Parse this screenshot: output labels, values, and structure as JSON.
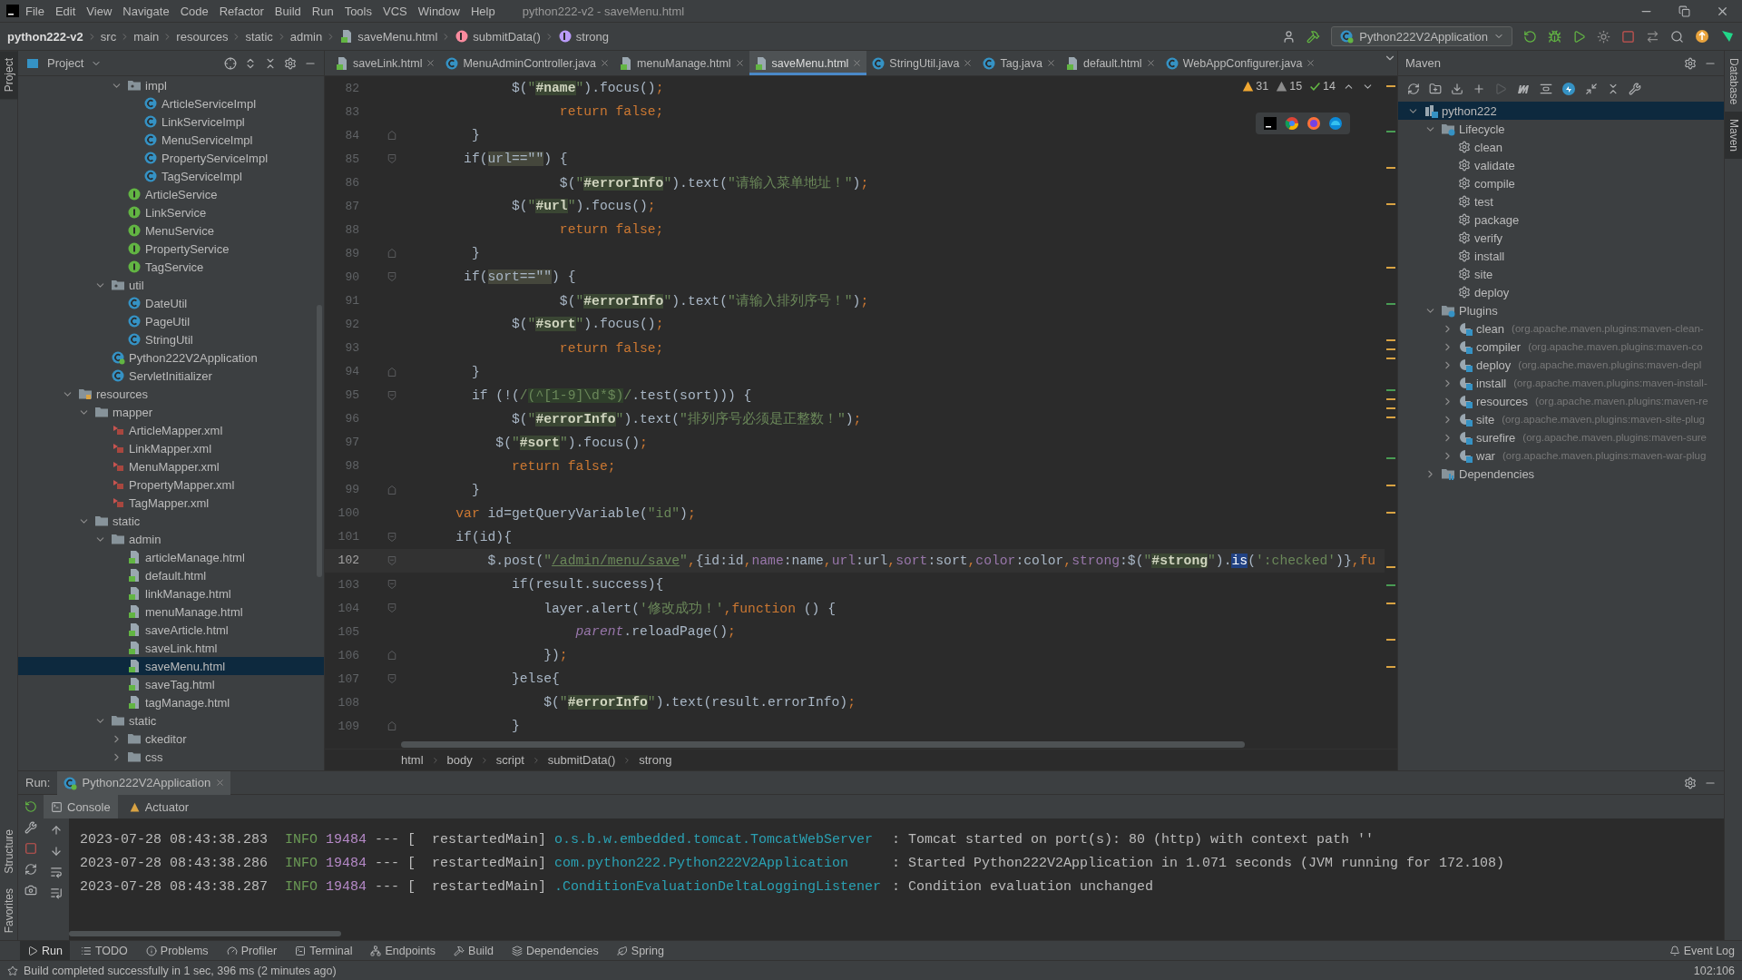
{
  "title_bar": {
    "menu": [
      "File",
      "Edit",
      "View",
      "Navigate",
      "Code",
      "Refactor",
      "Build",
      "Run",
      "Tools",
      "VCS",
      "Window",
      "Help"
    ],
    "title": "python222-v2 - saveMenu.html"
  },
  "nav_bar": {
    "crumbs": [
      {
        "label": "python222-v2",
        "kind": "project"
      },
      {
        "label": "src",
        "kind": "folder"
      },
      {
        "label": "main",
        "kind": "folder"
      },
      {
        "label": "resources",
        "kind": "folder"
      },
      {
        "label": "static",
        "kind": "folder"
      },
      {
        "label": "admin",
        "kind": "folder"
      },
      {
        "label": "saveMenu.html",
        "kind": "html"
      },
      {
        "label": "submitData()",
        "kind": "function"
      },
      {
        "label": "strong",
        "kind": "field"
      }
    ],
    "run_config": "Python222V2Application"
  },
  "left_stripe": [
    {
      "label": "Project",
      "selected": true
    }
  ],
  "left_stripe_bottom": [
    {
      "label": "Structure",
      "selected": false
    },
    {
      "label": "Favorites",
      "selected": false
    }
  ],
  "right_stripe": [
    {
      "label": "Database",
      "selected": false
    },
    {
      "label": "Maven",
      "selected": true
    }
  ],
  "project_panel": {
    "title": "Project",
    "tree": [
      {
        "children": [
          {
            "children": [
              {
                "children": [
                  {
                    "label": "impl",
                    "kind": "package",
                    "expanded": true,
                    "selected": false,
                    "children": [
                      {
                        "label": "ArticleServiceImpl",
                        "kind": "class",
                        "selected": false
                      },
                      {
                        "label": "LinkServiceImpl",
                        "kind": "class",
                        "selected": false
                      },
                      {
                        "label": "MenuServiceImpl",
                        "kind": "class",
                        "selected": false
                      },
                      {
                        "label": "PropertyServiceImpl",
                        "kind": "class",
                        "selected": false
                      },
                      {
                        "label": "TagServiceImpl",
                        "kind": "class",
                        "selected": false
                      }
                    ]
                  },
                  {
                    "label": "ArticleService",
                    "kind": "interface",
                    "selected": false
                  },
                  {
                    "label": "LinkService",
                    "kind": "interface",
                    "selected": false
                  },
                  {
                    "label": "MenuService",
                    "kind": "interface",
                    "selected": false
                  },
                  {
                    "label": "PropertyService",
                    "kind": "interface",
                    "selected": false
                  },
                  {
                    "label": "TagService",
                    "kind": "interface",
                    "selected": false
                  }
                ]
              },
              {
                "label": "util",
                "kind": "package",
                "expanded": true,
                "selected": false,
                "children": [
                  {
                    "label": "DateUtil",
                    "kind": "class",
                    "selected": false
                  },
                  {
                    "label": "PageUtil",
                    "kind": "class",
                    "selected": false
                  },
                  {
                    "label": "StringUtil",
                    "kind": "class",
                    "selected": false
                  }
                ]
              },
              {
                "label": "Python222V2Application",
                "kind": "app",
                "selected": false
              },
              {
                "label": "ServletInitializer",
                "kind": "class",
                "selected": false
              }
            ]
          }
        ]
      },
      {
        "label": "resources",
        "kind": "resources",
        "expanded": true,
        "selected": false,
        "children": [
          {
            "label": "mapper",
            "kind": "folder",
            "expanded": true,
            "selected": false,
            "children": [
              {
                "label": "ArticleMapper.xml",
                "kind": "xml",
                "selected": false
              },
              {
                "label": "LinkMapper.xml",
                "kind": "xml",
                "selected": false
              },
              {
                "label": "MenuMapper.xml",
                "kind": "xml",
                "selected": false
              },
              {
                "label": "PropertyMapper.xml",
                "kind": "xml",
                "selected": false
              },
              {
                "label": "TagMapper.xml",
                "kind": "xml",
                "selected": false
              }
            ]
          },
          {
            "label": "static",
            "kind": "folder",
            "expanded": true,
            "selected": false,
            "children": [
              {
                "label": "admin",
                "kind": "folder",
                "expanded": true,
                "selected": false,
                "children": [
                  {
                    "label": "articleManage.html",
                    "kind": "html",
                    "selected": false
                  },
                  {
                    "label": "default.html",
                    "kind": "html",
                    "selected": false
                  },
                  {
                    "label": "linkManage.html",
                    "kind": "html",
                    "selected": false
                  },
                  {
                    "label": "menuManage.html",
                    "kind": "html",
                    "selected": false
                  },
                  {
                    "label": "saveArticle.html",
                    "kind": "html",
                    "selected": false
                  },
                  {
                    "label": "saveLink.html",
                    "kind": "html",
                    "selected": false
                  },
                  {
                    "label": "saveMenu.html",
                    "kind": "html",
                    "selected": true
                  },
                  {
                    "label": "saveTag.html",
                    "kind": "html",
                    "selected": false
                  },
                  {
                    "label": "tagManage.html",
                    "kind": "html",
                    "selected": false
                  }
                ]
              },
              {
                "label": "static",
                "kind": "folder",
                "expanded": true,
                "selected": false,
                "children": [
                  {
                    "label": "ckeditor",
                    "kind": "folder",
                    "expanded": false,
                    "selected": false
                  },
                  {
                    "label": "css",
                    "kind": "folder",
                    "expanded": false,
                    "selected": false
                  }
                ]
              }
            ]
          }
        ]
      }
    ]
  },
  "editor": {
    "tabs": [
      {
        "label": "saveLink.html",
        "kind": "html",
        "selected": false
      },
      {
        "label": "MenuAdminController.java",
        "kind": "class",
        "selected": false
      },
      {
        "label": "menuManage.html",
        "kind": "html",
        "selected": false
      },
      {
        "label": "saveMenu.html",
        "kind": "html",
        "selected": true
      },
      {
        "label": "StringUtil.java",
        "kind": "class",
        "selected": false
      },
      {
        "label": "Tag.java",
        "kind": "class",
        "selected": false
      },
      {
        "label": "default.html",
        "kind": "html",
        "selected": false
      },
      {
        "label": "WebAppConfigurer.java",
        "kind": "class",
        "selected": false
      }
    ],
    "inspections": [
      {
        "count": "31",
        "kind": "warning"
      },
      {
        "count": "15",
        "kind": "weak"
      },
      {
        "count": "14",
        "kind": "ok"
      }
    ],
    "lines": [
      {
        "number": "82",
        "current": false,
        "tokens": [
          {
            "kind": "p",
            "text": "           $("
          },
          {
            "kind": "s",
            "text": "\""
          },
          {
            "kind": "id",
            "text": "#name"
          },
          {
            "kind": "s",
            "text": "\""
          },
          {
            "kind": "p",
            "text": ").focus()"
          },
          {
            "kind": "k",
            "text": ";"
          }
        ]
      },
      {
        "number": "83",
        "current": false,
        "tokens": [
          {
            "kind": "k",
            "text": "                 return false;"
          }
        ]
      },
      {
        "number": "84",
        "current": false,
        "fold": {
          "kind": "end"
        },
        "tokens": [
          {
            "kind": "p",
            "text": "      }"
          }
        ]
      },
      {
        "number": "85",
        "current": false,
        "fold": {
          "kind": "start"
        },
        "tokens": [
          {
            "kind": "p",
            "text": "     if("
          },
          {
            "kind": "h",
            "text": "url==\"\""
          },
          {
            "kind": "p",
            "text": ") {"
          }
        ]
      },
      {
        "number": "86",
        "current": false,
        "tokens": [
          {
            "kind": "p",
            "text": "                 $("
          },
          {
            "kind": "s",
            "text": "\""
          },
          {
            "kind": "id",
            "text": "#errorInfo"
          },
          {
            "kind": "s",
            "text": "\""
          },
          {
            "kind": "p",
            "text": ").text("
          },
          {
            "kind": "s",
            "text": "\"请输入菜单地址！\""
          },
          {
            "kind": "p",
            "text": ")"
          },
          {
            "kind": "k",
            "text": ";"
          }
        ]
      },
      {
        "number": "87",
        "current": false,
        "tokens": [
          {
            "kind": "p",
            "text": "           $("
          },
          {
            "kind": "s",
            "text": "\""
          },
          {
            "kind": "id",
            "text": "#url"
          },
          {
            "kind": "s",
            "text": "\""
          },
          {
            "kind": "p",
            "text": ").focus()"
          },
          {
            "kind": "k",
            "text": ";"
          }
        ]
      },
      {
        "number": "88",
        "current": false,
        "tokens": [
          {
            "kind": "k",
            "text": "                 return false;"
          }
        ]
      },
      {
        "number": "89",
        "current": false,
        "fold": {
          "kind": "end"
        },
        "tokens": [
          {
            "kind": "p",
            "text": "      }"
          }
        ]
      },
      {
        "number": "90",
        "current": false,
        "fold": {
          "kind": "start"
        },
        "tokens": [
          {
            "kind": "p",
            "text": "     if("
          },
          {
            "kind": "h",
            "text": "sort==\"\""
          },
          {
            "kind": "p",
            "text": ") {"
          }
        ]
      },
      {
        "number": "91",
        "current": false,
        "tokens": [
          {
            "kind": "p",
            "text": "                 $("
          },
          {
            "kind": "s",
            "text": "\""
          },
          {
            "kind": "id",
            "text": "#errorInfo"
          },
          {
            "kind": "s",
            "text": "\""
          },
          {
            "kind": "p",
            "text": ").text("
          },
          {
            "kind": "s",
            "text": "\"请输入排列序号！\""
          },
          {
            "kind": "p",
            "text": ")"
          },
          {
            "kind": "k",
            "text": ";"
          }
        ]
      },
      {
        "number": "92",
        "current": false,
        "tokens": [
          {
            "kind": "p",
            "text": "           $("
          },
          {
            "kind": "s",
            "text": "\""
          },
          {
            "kind": "id",
            "text": "#sort"
          },
          {
            "kind": "s",
            "text": "\""
          },
          {
            "kind": "p",
            "text": ").focus()"
          },
          {
            "kind": "k",
            "text": ";"
          }
        ]
      },
      {
        "number": "93",
        "current": false,
        "tokens": [
          {
            "kind": "k",
            "text": "                 return false;"
          }
        ]
      },
      {
        "number": "94",
        "current": false,
        "fold": {
          "kind": "end"
        },
        "tokens": [
          {
            "kind": "p",
            "text": "      }"
          }
        ]
      },
      {
        "number": "95",
        "current": false,
        "fold": {
          "kind": "start"
        },
        "tokens": [
          {
            "kind": "p",
            "text": "      if (!("
          },
          {
            "kind": "s",
            "text": "/"
          },
          {
            "kind": "r",
            "text": "(^[1-9]\\d*$)"
          },
          {
            "kind": "s",
            "text": "/"
          },
          {
            "kind": "p",
            "text": ".test(sort))) {"
          }
        ]
      },
      {
        "number": "96",
        "current": false,
        "tokens": [
          {
            "kind": "p",
            "text": "           $("
          },
          {
            "kind": "s",
            "text": "\""
          },
          {
            "kind": "id",
            "text": "#errorInfo"
          },
          {
            "kind": "s",
            "text": "\""
          },
          {
            "kind": "p",
            "text": ").text("
          },
          {
            "kind": "s",
            "text": "\"排列序号必须是正整数！\""
          },
          {
            "kind": "p",
            "text": ")"
          },
          {
            "kind": "k",
            "text": ";"
          }
        ]
      },
      {
        "number": "97",
        "current": false,
        "tokens": [
          {
            "kind": "p",
            "text": "         $("
          },
          {
            "kind": "s",
            "text": "\""
          },
          {
            "kind": "id",
            "text": "#sort"
          },
          {
            "kind": "s",
            "text": "\""
          },
          {
            "kind": "p",
            "text": ").focus()"
          },
          {
            "kind": "k",
            "text": ";"
          }
        ]
      },
      {
        "number": "98",
        "current": false,
        "tokens": [
          {
            "kind": "k",
            "text": "           return false;"
          }
        ]
      },
      {
        "number": "99",
        "current": false,
        "fold": {
          "kind": "end"
        },
        "tokens": [
          {
            "kind": "p",
            "text": "      }"
          }
        ]
      },
      {
        "number": "100",
        "current": false,
        "tokens": [
          {
            "kind": "k",
            "text": "    var"
          },
          {
            "kind": "p",
            "text": " id=getQueryVariable("
          },
          {
            "kind": "s",
            "text": "\"id\""
          },
          {
            "kind": "p",
            "text": ")"
          },
          {
            "kind": "k",
            "text": ";"
          }
        ]
      },
      {
        "number": "101",
        "current": false,
        "fold": {
          "kind": "start"
        },
        "tokens": [
          {
            "kind": "p",
            "text": "    if(id){"
          }
        ]
      },
      {
        "number": "102",
        "current": true,
        "fold": {
          "kind": "start"
        },
        "tokens": [
          {
            "kind": "p",
            "text": "        $.post("
          },
          {
            "kind": "s",
            "text": "\""
          },
          {
            "kind": "l",
            "text": "/admin/menu/save"
          },
          {
            "kind": "s",
            "text": "\""
          },
          {
            "kind": "k",
            "text": ","
          },
          {
            "kind": "p",
            "text": "{id:id"
          },
          {
            "kind": "k",
            "text": ","
          },
          {
            "kind": "v",
            "text": "name"
          },
          {
            "kind": "p",
            "text": ":name"
          },
          {
            "kind": "k",
            "text": ","
          },
          {
            "kind": "v",
            "text": "url"
          },
          {
            "kind": "p",
            "text": ":url"
          },
          {
            "kind": "k",
            "text": ","
          },
          {
            "kind": "v",
            "text": "sort"
          },
          {
            "kind": "p",
            "text": ":sort"
          },
          {
            "kind": "k",
            "text": ","
          },
          {
            "kind": "v",
            "text": "color"
          },
          {
            "kind": "p",
            "text": ":color"
          },
          {
            "kind": "k",
            "text": ","
          },
          {
            "kind": "v",
            "text": "strong"
          },
          {
            "kind": "p",
            "text": ":$("
          },
          {
            "kind": "s",
            "text": "\""
          },
          {
            "kind": "id",
            "text": "#strong"
          },
          {
            "kind": "s",
            "text": "\""
          },
          {
            "kind": "p",
            "text": ")."
          },
          {
            "kind": "sel",
            "text": "is"
          },
          {
            "kind": "p",
            "text": "("
          },
          {
            "kind": "s",
            "text": "':checked'"
          },
          {
            "kind": "p",
            "text": ")}"
          },
          {
            "kind": "k",
            "text": ",fu"
          }
        ]
      },
      {
        "number": "103",
        "current": false,
        "fold": {
          "kind": "start"
        },
        "tokens": [
          {
            "kind": "p",
            "text": "           if(result.success){"
          }
        ]
      },
      {
        "number": "104",
        "current": false,
        "fold": {
          "kind": "start"
        },
        "tokens": [
          {
            "kind": "p",
            "text": "               layer.alert("
          },
          {
            "kind": "s",
            "text": "'修改成功！'"
          },
          {
            "kind": "k",
            "text": ",function"
          },
          {
            "kind": "p",
            "text": " () {"
          }
        ]
      },
      {
        "number": "105",
        "current": false,
        "tokens": [
          {
            "kind": "i",
            "text": "                   parent"
          },
          {
            "kind": "p",
            "text": ".reloadPage()"
          },
          {
            "kind": "k",
            "text": ";"
          }
        ]
      },
      {
        "number": "106",
        "current": false,
        "fold": {
          "kind": "end"
        },
        "tokens": [
          {
            "kind": "p",
            "text": "               })"
          },
          {
            "kind": "k",
            "text": ";"
          }
        ]
      },
      {
        "number": "107",
        "current": false,
        "fold": {
          "kind": "start"
        },
        "tokens": [
          {
            "kind": "p",
            "text": "           }else{"
          }
        ]
      },
      {
        "number": "108",
        "current": false,
        "tokens": [
          {
            "kind": "p",
            "text": "               $("
          },
          {
            "kind": "s",
            "text": "\""
          },
          {
            "kind": "id",
            "text": "#errorInfo"
          },
          {
            "kind": "s",
            "text": "\""
          },
          {
            "kind": "p",
            "text": ").text(result.errorInfo)"
          },
          {
            "kind": "k",
            "text": ";"
          }
        ]
      },
      {
        "number": "109",
        "current": false,
        "fold": {
          "kind": "end"
        },
        "tokens": [
          {
            "kind": "p",
            "text": "           }"
          }
        ]
      }
    ],
    "breadcrumb": [
      "html",
      "body",
      "script",
      "submitData()",
      "strong"
    ]
  },
  "maven_panel": {
    "title": "Maven",
    "tree": [
      {
        "label": "python222",
        "kind": "project",
        "expanded": true,
        "selected": true,
        "children": [
          {
            "label": "Lifecycle",
            "kind": "lifecycle",
            "expanded": true,
            "selected": false,
            "children": [
              {
                "label": "clean",
                "kind": "goal",
                "selected": false
              },
              {
                "label": "validate",
                "kind": "goal",
                "selected": false
              },
              {
                "label": "compile",
                "kind": "goal",
                "selected": false
              },
              {
                "label": "test",
                "kind": "goal",
                "selected": false
              },
              {
                "label": "package",
                "kind": "goal",
                "selected": false
              },
              {
                "label": "verify",
                "kind": "goal",
                "selected": false
              },
              {
                "label": "install",
                "kind": "goal",
                "selected": false
              },
              {
                "label": "site",
                "kind": "goal",
                "selected": false
              },
              {
                "label": "deploy",
                "kind": "goal",
                "selected": false
              }
            ]
          },
          {
            "label": "Plugins",
            "kind": "lifecycle",
            "expanded": true,
            "selected": false,
            "children": [
              {
                "label": "clean",
                "detail": "(org.apache.maven.plugins:maven-clean-",
                "kind": "plugin",
                "expanded": false,
                "selected": false
              },
              {
                "label": "compiler",
                "detail": "(org.apache.maven.plugins:maven-co",
                "kind": "plugin",
                "expanded": false,
                "selected": false
              },
              {
                "label": "deploy",
                "detail": "(org.apache.maven.plugins:maven-depl",
                "kind": "plugin",
                "expanded": false,
                "selected": false
              },
              {
                "label": "install",
                "detail": "(org.apache.maven.plugins:maven-install-",
                "kind": "plugin",
                "expanded": false,
                "selected": false
              },
              {
                "label": "resources",
                "detail": "(org.apache.maven.plugins:maven-re",
                "kind": "plugin",
                "expanded": false,
                "selected": false
              },
              {
                "label": "site",
                "detail": "(org.apache.maven.plugins:maven-site-plug",
                "kind": "plugin",
                "expanded": false,
                "selected": false
              },
              {
                "label": "surefire",
                "detail": "(org.apache.maven.plugins:maven-sure",
                "kind": "plugin",
                "expanded": false,
                "selected": false
              },
              {
                "label": "war",
                "detail": "(org.apache.maven.plugins:maven-war-plug",
                "kind": "plugin",
                "expanded": false,
                "selected": false
              }
            ]
          },
          {
            "label": "Dependencies",
            "kind": "dependencies",
            "expanded": false,
            "selected": false
          }
        ]
      }
    ]
  },
  "run_panel": {
    "label": "Run:",
    "tab": "Python222V2Application",
    "subtabs": [
      {
        "label": "Console",
        "kind": "console",
        "selected": true
      },
      {
        "label": "Actuator",
        "kind": "actuator",
        "selected": false
      }
    ],
    "log": [
      {
        "time": "2023-07-28 08:43:38.283",
        "level": "INFO",
        "pid": "19484",
        "thread": "--- [  restartedMain]",
        "logger": "o.s.b.w.embedded.tomcat.TomcatWebServer",
        "message": ": Tomcat started on port(s): 80 (http) with context path ''"
      },
      {
        "time": "2023-07-28 08:43:38.286",
        "level": "INFO",
        "pid": "19484",
        "thread": "--- [  restartedMain]",
        "logger": "com.python222.Python222V2Application",
        "message": ": Started Python222V2Application in 1.071 seconds (JVM running for 172.108)"
      },
      {
        "time": "2023-07-28 08:43:38.287",
        "level": "INFO",
        "pid": "19484",
        "thread": "--- [  restartedMain]",
        "logger": ".ConditionEvaluationDeltaLoggingListener",
        "message": ": Condition evaluation unchanged"
      }
    ]
  },
  "tool_bar": {
    "items": [
      {
        "label": "Run",
        "kind": "run",
        "selected": true
      },
      {
        "label": "TODO",
        "kind": "todo",
        "selected": false
      },
      {
        "label": "Problems",
        "kind": "problems",
        "selected": false
      },
      {
        "label": "Profiler",
        "kind": "profiler",
        "selected": false
      },
      {
        "label": "Terminal",
        "kind": "terminal",
        "selected": false
      },
      {
        "label": "Endpoints",
        "kind": "endpoints",
        "selected": false
      },
      {
        "label": "Build",
        "kind": "build",
        "selected": false
      },
      {
        "label": "Dependencies",
        "kind": "dependencies",
        "selected": false
      },
      {
        "label": "Spring",
        "kind": "spring",
        "selected": false
      }
    ],
    "event_log": "Event Log"
  },
  "status_bar": {
    "message": "Build completed successfully in 1 sec, 396 ms (2 minutes ago)",
    "position": "102:106"
  }
}
